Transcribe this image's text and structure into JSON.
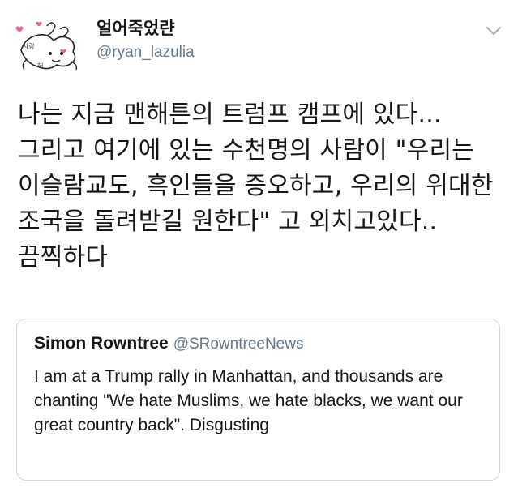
{
  "tweet": {
    "display_name": "얼어죽었랸",
    "handle": "@ryan_lazulia",
    "text": "나는 지금 맨해튼의 트럼프 캠프에 있다... 그리고 여기에 있는 수천명의 사람이 \"우리는 이슬람교도, 흑인들을 증오하고, 우리의 위대한 조국을 돌려받길 원한다\" 고 외치고있다.. 끔찍하다",
    "menu_icon": "chevron-down-icon"
  },
  "quoted_tweet": {
    "display_name": "Simon Rowntree",
    "handle": "@SRowntreeNews",
    "text": "I am at a Trump rally in Manhattan, and thousands are chanting \"We hate Muslims, we hate blacks, we want our great country back\". Disgusting"
  },
  "colors": {
    "text_primary": "#14171a",
    "text_secondary": "#657786",
    "border": "#ccd6dd",
    "avatar_heart": "#e8609a",
    "chevron": "#a3b3bf"
  }
}
